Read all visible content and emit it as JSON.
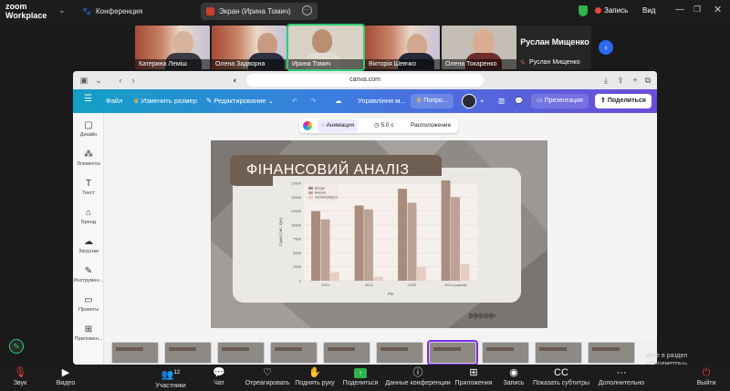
{
  "zoom": {
    "logo_line1": "zoom",
    "logo_line2": "Workplace",
    "tabs": [
      {
        "label": "Конференция"
      },
      {
        "label": "Экран (Ирина Томич)"
      }
    ],
    "top_right": {
      "record": "Запись",
      "view": "Вид"
    },
    "participants": [
      {
        "name": "Катерина Леміш"
      },
      {
        "name": "Олена Задворна"
      },
      {
        "name": "Ирина Томич"
      },
      {
        "name": "Вікторія Шевчко"
      },
      {
        "name": "Олена Токаренко"
      },
      {
        "name": "Руслан Мищенко"
      }
    ],
    "name_tile_big": "Руслан Мищенко",
    "bottom": {
      "audio": "Звук",
      "video": "Видео",
      "participants": "Участники",
      "participants_count": "12",
      "chat": "Чат",
      "react": "Отреагировать",
      "raise_hand": "Поднять руку",
      "share": "Поделиться",
      "conf_data": "Данные конференции",
      "apps": "Приложения",
      "record": "Запись",
      "captions": "Показать субтитры",
      "more": "Дополнительно",
      "leave": "Выйти"
    },
    "hint_text": "дите в раздел «Параметры»."
  },
  "browser": {
    "url": "canva.com"
  },
  "canva": {
    "file": "Файл",
    "resize": "Изменить размер",
    "editing": "Редактирование",
    "doc_title": "Управління м...",
    "try_pro": "Попро...",
    "present": "Презентация",
    "share": "Поделиться",
    "rail": [
      {
        "label": "Дизайн",
        "icon": "design-icon"
      },
      {
        "label": "Элементы",
        "icon": "elements-icon"
      },
      {
        "label": "Текст",
        "icon": "text-icon"
      },
      {
        "label": "Бренд",
        "icon": "brand-icon"
      },
      {
        "label": "Загрузки",
        "icon": "uploads-icon"
      },
      {
        "label": "Инструмен...",
        "icon": "tools-icon"
      },
      {
        "label": "Проекты",
        "icon": "projects-icon"
      },
      {
        "label": "Приложен...",
        "icon": "apps-icon"
      }
    ],
    "toolbar": {
      "animation": "Анимация",
      "duration": "5.0 с",
      "position": "Расположение"
    },
    "slide_title": "ФІНАНСОВИЙ АНАЛІЗ"
  },
  "chart_data": {
    "type": "bar",
    "title": "",
    "xlabel": "Рік",
    "ylabel": "Сума (тис. грн)",
    "categories": [
      "2021",
      "2022",
      "2023",
      "2024 (оцінка)"
    ],
    "ylim": [
      0,
      17500
    ],
    "yticks": [
      0,
      2500,
      5000,
      7500,
      10000,
      12500,
      15000,
      17500
    ],
    "legend_position": "top-left",
    "series": [
      {
        "name": "Доходи",
        "color": "#a88d7f",
        "values": [
          12500,
          13500,
          16500,
          18000
        ]
      },
      {
        "name": "Витрати",
        "color": "#bda296",
        "values": [
          11000,
          12800,
          14000,
          15000
        ]
      },
      {
        "name": "Чистий прибуток",
        "color": "#e7cdc4",
        "values": [
          1500,
          700,
          2500,
          3000
        ]
      }
    ]
  }
}
